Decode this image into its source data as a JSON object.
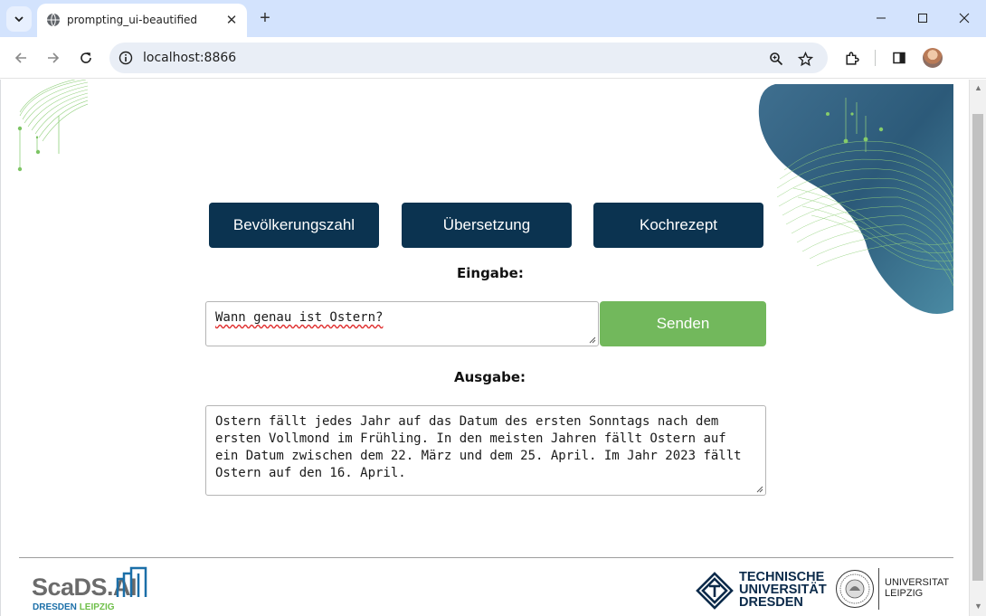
{
  "browser": {
    "tab_title": "prompting_ui-beautified",
    "url": "localhost:8866",
    "new_tab_symbol": "+",
    "close_tab_symbol": "✕"
  },
  "presets": [
    {
      "label": "Bevölkerungszahl"
    },
    {
      "label": "Übersetzung"
    },
    {
      "label": "Kochrezept"
    }
  ],
  "input": {
    "label": "Eingabe:",
    "value": "Wann genau ist Ostern?",
    "send_label": "Senden"
  },
  "output": {
    "label": "Ausgabe:",
    "value": "Ostern fällt jedes Jahr auf das Datum des ersten Sonntags nach dem ersten Vollmond im Frühling. In den meisten Jahren fällt Ostern auf ein Datum zwischen dem 22. März und dem 25. April. Im Jahr 2023 fällt Ostern auf den 16. April."
  },
  "footer": {
    "scads_name": "ScaDS.AI",
    "scads_city_1": "DRESDEN",
    "scads_city_2": "LEIPZIG",
    "tud_line1": "TECHNISCHE",
    "tud_line2": "UNIVERSITÄT",
    "tud_line3": "DRESDEN",
    "leipzig_line1": "UNIVERSITAT",
    "leipzig_line2": "LEIPZIG"
  },
  "colors": {
    "preset_button": "#0b3350",
    "send_button": "#72b85c",
    "tab_bar": "#d3e3fd",
    "omnibox": "#e9eef6"
  },
  "icons": [
    "tab-search-icon",
    "globe-favicon-icon",
    "close-icon",
    "plus-icon",
    "minimize-icon",
    "maximize-icon",
    "window-close-icon",
    "back-arrow-icon",
    "forward-arrow-icon",
    "reload-icon",
    "site-info-icon",
    "zoom-icon",
    "star-icon",
    "extensions-icon",
    "side-panel-icon",
    "avatar"
  ]
}
